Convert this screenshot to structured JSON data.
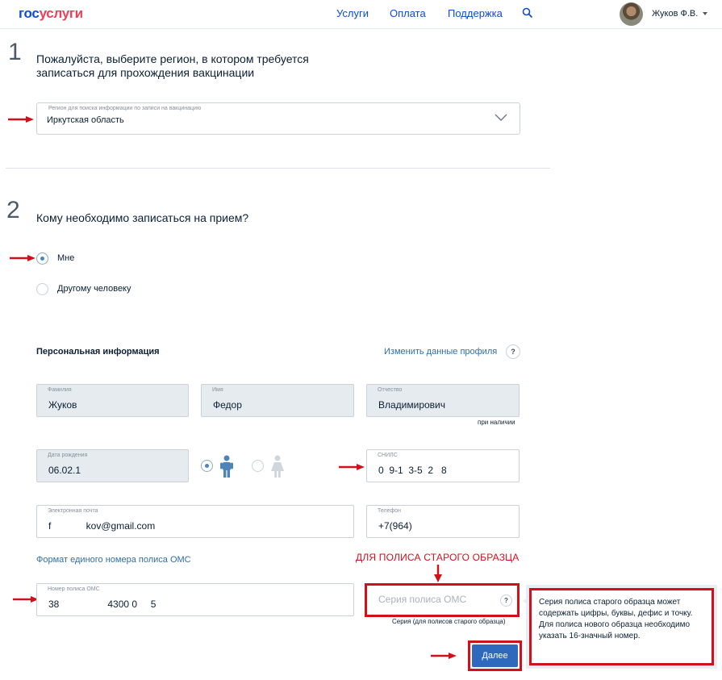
{
  "header": {
    "logo_part1": "гос",
    "logo_part2": "услуги",
    "nav": [
      "Услуги",
      "Оплата",
      "Поддержка"
    ],
    "user_name": "Жуков Ф.В."
  },
  "step1": {
    "number": "1",
    "title_line1": "Пожалуйста, выберите регион, в котором требуется",
    "title_line2": "записаться для прохождения вакцинации",
    "select_label": "Регион для поиска информации по записи на вакцинацию",
    "select_value": "Иркутская область"
  },
  "step2": {
    "number": "2",
    "title": "Кому необходимо записаться на прием?",
    "options": [
      {
        "label": "Мне",
        "selected": true
      },
      {
        "label": "Другому человеку",
        "selected": false
      }
    ]
  },
  "personal": {
    "heading": "Персональная информация",
    "edit_link": "Изменить данные профиля",
    "help": "?",
    "last_name": {
      "label": "Фамилия",
      "value": "Жуков"
    },
    "first_name": {
      "label": "Имя",
      "value": "Федор"
    },
    "patronymic": {
      "label": "Отчество",
      "value": "Владимирович",
      "note": "при наличии"
    },
    "birth_date": {
      "label": "Дата рождения",
      "value": "06.02.1"
    },
    "gender": {
      "selected": "male"
    },
    "snils": {
      "label": "СНИЛС",
      "value": "0  9-1  3-5  2   8"
    },
    "email": {
      "label": "Электронная почта",
      "value": "f             kov@gmail.com"
    },
    "phone": {
      "label": "Телефон",
      "value": "+7(964)"
    },
    "oms_format_link": "Формат единого номера полиса ОМС",
    "oms_number": {
      "label": "Номер полиса ОМС",
      "value": "38                  4300 0     5"
    },
    "oms_series": {
      "placeholder": "Серия полиса ОМС",
      "note": "Серия (для полисов старого образца)"
    }
  },
  "annotation": {
    "title": "ДЛЯ ПОЛИСА СТАРОГО ОБРАЗЦА",
    "color": "#d0101a"
  },
  "tooltip": {
    "line1": "Серия полиса старого образца может содержать цифры, буквы, дефис и точку.",
    "line2": "Для полиса нового образца необходимо указать 16-значный номер."
  },
  "submit_label": "Далее",
  "colors": {
    "brand_blue": "#0d4cd3",
    "brand_red": "#ee3f58",
    "button": "#2e69bd"
  }
}
